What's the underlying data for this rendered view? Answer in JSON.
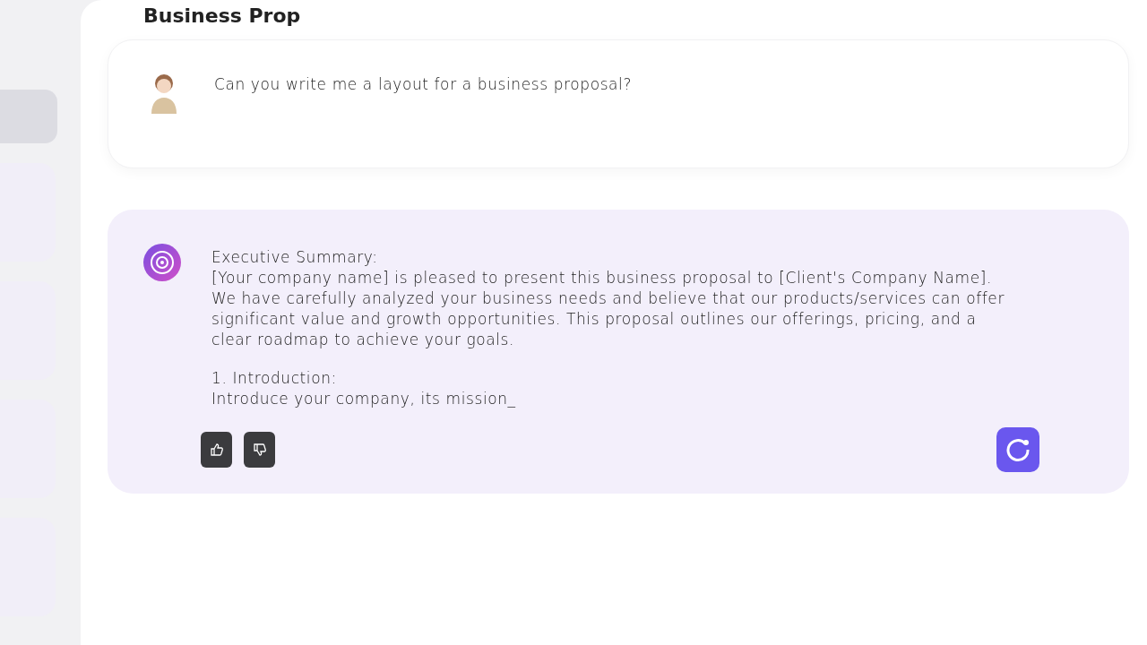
{
  "title": "Business Prop",
  "messages": [
    {
      "kind": "user",
      "blocks": [
        {
          "lines": [
            "Can you write me a layout for a business proposal?"
          ]
        }
      ]
    },
    {
      "kind": "assistant",
      "blocks": [
        {
          "lines": [
            "Executive Summary:",
            "[Your company name] is pleased to present this business proposal to [Client's Company Name].",
            "We have carefully analyzed your business needs and believe that our products/services can offer",
            "significant value and growth opportunities. This proposal outlines our offerings, pricing, and a",
            "clear roadmap to achieve your goals."
          ]
        },
        {
          "lines": [
            "1. Introduction:",
            "Introduce your company, its mission_"
          ]
        }
      ]
    }
  ],
  "feedback": [
    {
      "kind": "like"
    },
    {
      "kind": "dislike"
    }
  ]
}
